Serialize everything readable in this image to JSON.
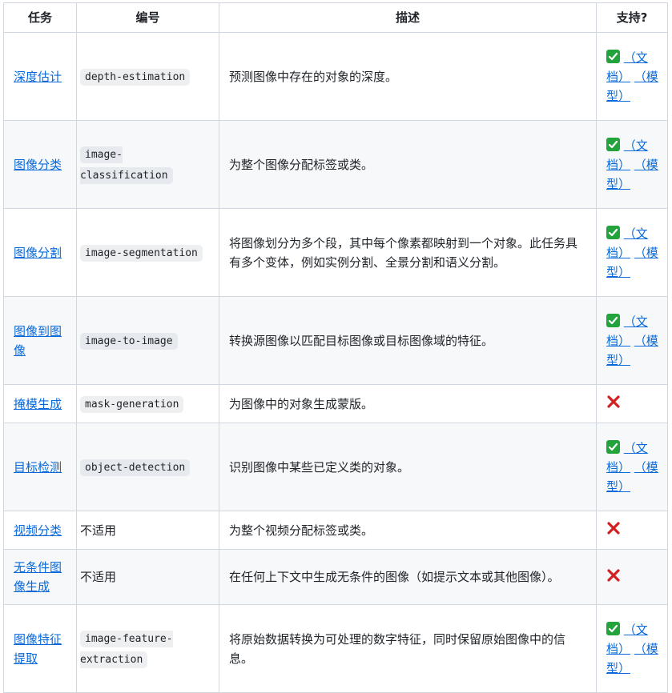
{
  "headers": {
    "task": "任务",
    "id": "编号",
    "desc": "描述",
    "support": "支持?"
  },
  "doc_label": "（文档）",
  "model_label": "（模型）",
  "rows": [
    {
      "task": "深度估计",
      "id": "depth-estimation",
      "code": true,
      "desc": "预测图像中存在的对象的深度。",
      "supported": true
    },
    {
      "task": "图像分类",
      "id": "image-classification",
      "code": true,
      "desc": "为整个图像分配标签或类。",
      "supported": true
    },
    {
      "task": "图像分割",
      "id": "image-segmentation",
      "code": true,
      "desc": "将图像划分为多个段，其中每个像素都映射到一个对象。此任务具有多个变体，例如实例分割、全景分割和语义分割。",
      "supported": true
    },
    {
      "task": "图像到图像",
      "id": "image-to-image",
      "code": true,
      "desc": "转换源图像以匹配目标图像或目标图像域的特征。",
      "supported": true
    },
    {
      "task": "掩模生成",
      "id": "mask-generation",
      "code": true,
      "desc": "为图像中的对象生成蒙版。",
      "supported": false
    },
    {
      "task": "目标检测",
      "id": "object-detection",
      "code": true,
      "desc": "识别图像中某些已定义类的对象。",
      "supported": true
    },
    {
      "task": "视频分类",
      "id": "不适用",
      "code": false,
      "desc": "为整个视频分配标签或类。",
      "supported": false
    },
    {
      "task": "无条件图像生成",
      "id": "不适用",
      "code": false,
      "desc": "在任何上下文中生成无条件的图像（如提示文本或其他图像）。",
      "supported": false
    },
    {
      "task": "图像特征提取",
      "id": "image-feature-extraction",
      "code": true,
      "desc": "将原始数据转换为可处理的数字特征，同时保留原始图像中的信息。",
      "supported": true
    }
  ],
  "colors": {
    "link": "#0969da",
    "check": "#23a33b",
    "cross": "#d21f1f",
    "border": "#d0d7de",
    "stripe": "#f6f8fa"
  }
}
